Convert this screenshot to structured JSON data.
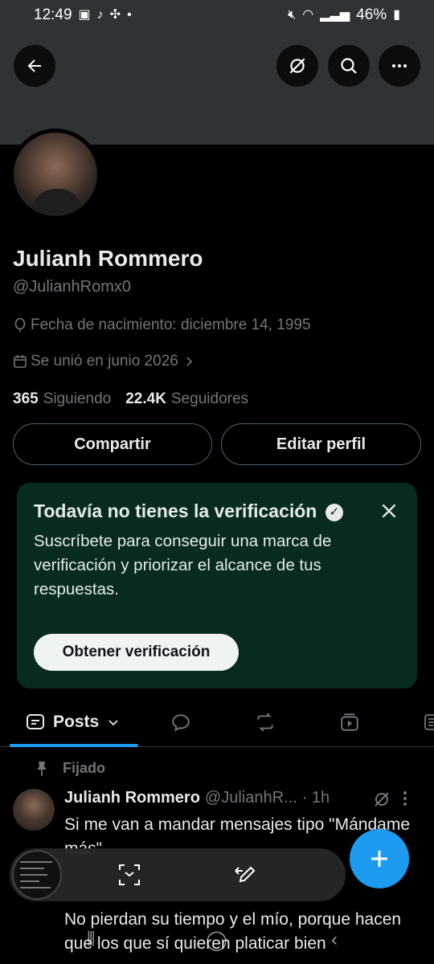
{
  "status": {
    "time": "12:49",
    "battery": "46%"
  },
  "profile": {
    "name": "Julianh Rommero",
    "handle": "@JulianhRomx0",
    "birthdate": "Fecha de nacimiento: diciembre 14, 1995",
    "joined": "Se unió en junio 2026",
    "following_count": "365",
    "following_label": "Siguiendo",
    "followers_count": "22.4K",
    "followers_label": "Seguidores"
  },
  "actions": {
    "share": "Compartir",
    "edit": "Editar perfil"
  },
  "verification": {
    "title": "Todavía no tienes la verificación",
    "body": "Suscríbete para conseguir una marca de verificación y priorizar el alcance de tus respuestas.",
    "button": "Obtener verificación"
  },
  "tabs": {
    "posts": "Posts"
  },
  "post": {
    "pinned_label": "Fijado",
    "author": "Julianh Rommero",
    "handle": "@JulianhR...",
    "time": "· 1h",
    "text1": "Si me van a mandar mensajes tipo \"Mándame más\"",
    "text2": "No pierdan su tiempo y el mío, porque hacen que los que sí quieren platicar bien"
  },
  "colors": {
    "accent": "#1d9bf0",
    "verification_bg": "#072a21"
  }
}
